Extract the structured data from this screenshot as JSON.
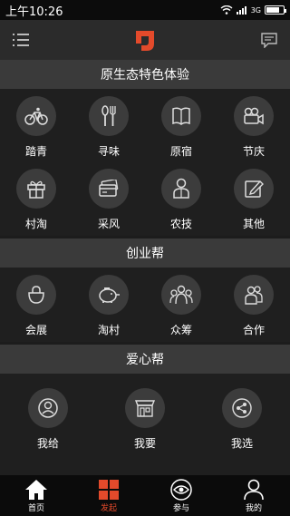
{
  "status_bar": {
    "time": "上午10:26",
    "network": "3G",
    "battery_level": 0.8
  },
  "header": {
    "menu_icon": "list-icon",
    "logo_icon": "brand-logo",
    "message_icon": "message-icon"
  },
  "sections": [
    {
      "title": "原生态特色体验",
      "items": [
        {
          "label": "踏青",
          "icon": "bicycle-icon"
        },
        {
          "label": "寻味",
          "icon": "utensils-icon"
        },
        {
          "label": "原宿",
          "icon": "book-icon"
        },
        {
          "label": "节庆",
          "icon": "camera-icon"
        },
        {
          "label": "村淘",
          "icon": "gift-icon"
        },
        {
          "label": "采风",
          "icon": "card-icon"
        },
        {
          "label": "农技",
          "icon": "person-icon"
        },
        {
          "label": "其他",
          "icon": "edit-icon"
        }
      ]
    },
    {
      "title": "创业帮",
      "items": [
        {
          "label": "会展",
          "icon": "bag-icon"
        },
        {
          "label": "淘村",
          "icon": "piggy-bank-icon"
        },
        {
          "label": "众筹",
          "icon": "group-icon"
        },
        {
          "label": "合作",
          "icon": "partners-icon"
        }
      ]
    },
    {
      "title": "爱心帮",
      "items": [
        {
          "label": "我给",
          "icon": "user-circle-icon"
        },
        {
          "label": "我要",
          "icon": "storefront-icon"
        },
        {
          "label": "我选",
          "icon": "share-icon"
        }
      ]
    }
  ],
  "tabs": [
    {
      "label": "首页",
      "icon": "home-icon",
      "color": "#ffffff"
    },
    {
      "label": "发起",
      "icon": "grid-icon",
      "color": "#e34a2b"
    },
    {
      "label": "参与",
      "icon": "eye-icon",
      "color": "#ffffff"
    },
    {
      "label": "我的",
      "icon": "user-icon",
      "color": "#ffffff"
    }
  ],
  "colors": {
    "accent": "#e34a2b",
    "background": "#1f1f1f",
    "section": "#3a3a3a"
  }
}
